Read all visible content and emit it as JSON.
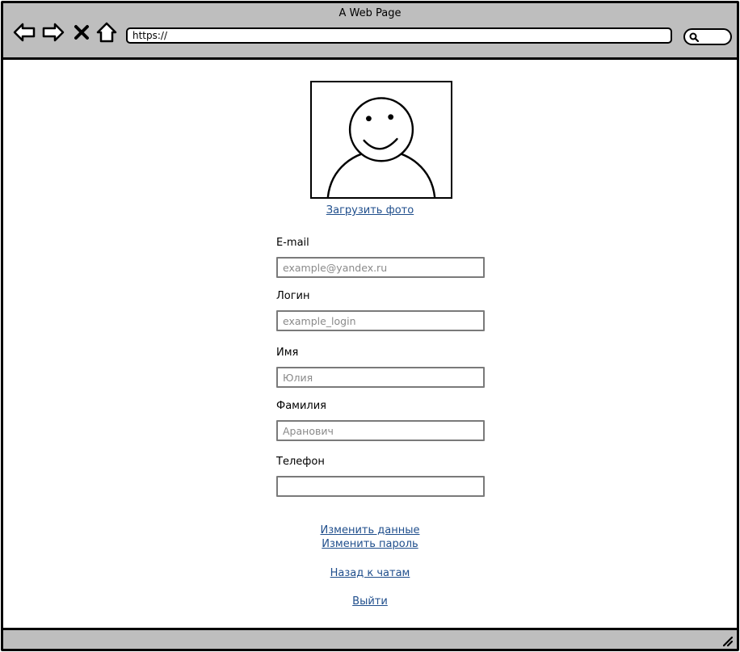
{
  "window": {
    "title": "A Web Page",
    "url": "https://"
  },
  "nav": {
    "icons": [
      "back-arrow-icon",
      "forward-arrow-icon",
      "close-x-icon",
      "home-icon"
    ]
  },
  "profile": {
    "upload_photo_label": "Загрузить фото"
  },
  "form": {
    "email": {
      "label": "E-mail",
      "placeholder": "example@yandex.ru"
    },
    "login": {
      "label": "Логин",
      "placeholder": "example_login"
    },
    "first_name": {
      "label": "Имя",
      "placeholder": "Юлия"
    },
    "last_name": {
      "label": "Фамилия",
      "placeholder": "Аранович"
    },
    "phone": {
      "label": "Телефон",
      "placeholder": ""
    }
  },
  "actions": {
    "change_data": "Изменить данные",
    "change_password": "Изменить пароль",
    "back_to_chats": "Назад к чатам",
    "logout": "Выйти"
  },
  "colors": {
    "chrome": "#bebebe",
    "link": "#1f4e8c",
    "input_border": "#7a7a7a"
  }
}
